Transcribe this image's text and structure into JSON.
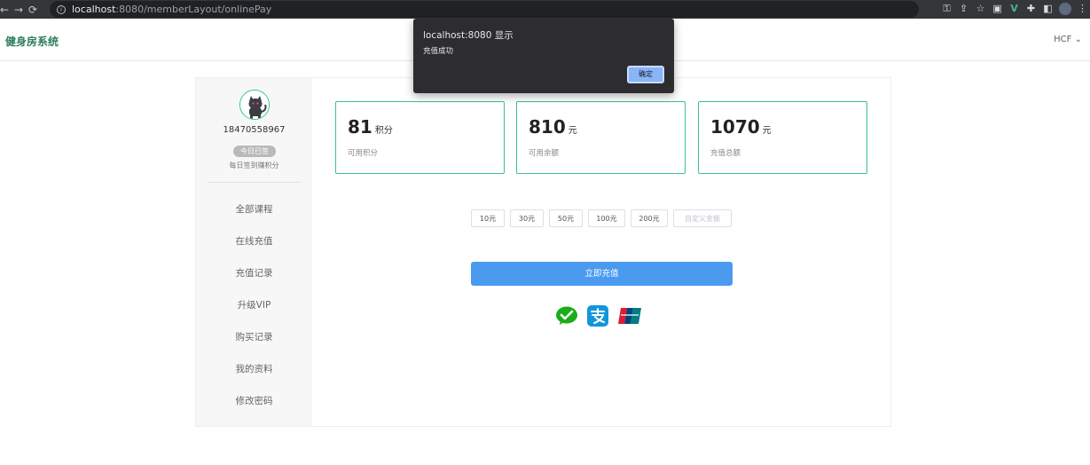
{
  "browser": {
    "url_host": "localhost",
    "url_rest": ":8080/memberLayout/onlinePay"
  },
  "header": {
    "brand": "健身房系统",
    "user": "HCF"
  },
  "profile": {
    "phone": "18470558967",
    "sign_badge": "今日已签",
    "sign_tip": "每日签到赚积分"
  },
  "menu": [
    "全部课程",
    "在线充值",
    "充值记录",
    "升级VIP",
    "购买记录",
    "我的资料",
    "修改密码"
  ],
  "stats": [
    {
      "value": "81",
      "unit": "积分",
      "label": "可用积分"
    },
    {
      "value": "810",
      "unit": "元",
      "label": "可用余额"
    },
    {
      "value": "1070",
      "unit": "元",
      "label": "充值总额"
    }
  ],
  "amounts": [
    "10元",
    "30元",
    "50元",
    "100元",
    "200元"
  ],
  "custom_amount_placeholder": "自定义金额",
  "pay_button": "立即充值",
  "payment_methods": [
    "wechat-pay-icon",
    "alipay-icon",
    "unionpay-icon"
  ],
  "dialog": {
    "title": "localhost:8080 显示",
    "message": "充值成功",
    "ok": "确定"
  },
  "colors": {
    "accent_green": "#3bbf9a",
    "brand_green": "#2e7d5b",
    "primary_blue": "#4a9bf0"
  }
}
